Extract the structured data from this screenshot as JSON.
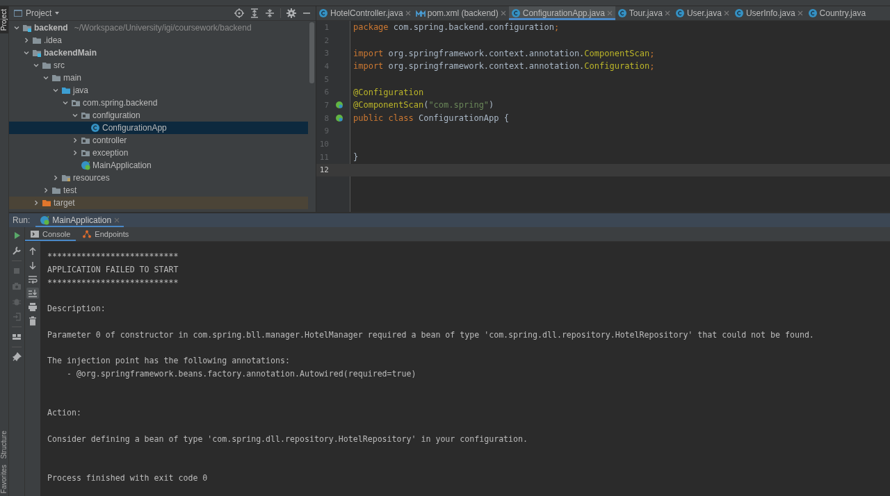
{
  "side_tools": [
    {
      "label": "Project",
      "kind": "top",
      "selected": true
    },
    {
      "label": "Structure",
      "kind": "bottom",
      "selected": false
    },
    {
      "label": "Favorites",
      "kind": "bottom",
      "selected": false
    }
  ],
  "project": {
    "title": "Project",
    "tree": [
      {
        "label": "backend",
        "kind": "module",
        "hint": "~/Workspace/University/igi/coursework/backend",
        "expanded": true,
        "selected": false,
        "children": [
          {
            "label": ".idea",
            "kind": "folder",
            "expanded": false,
            "selected": false
          },
          {
            "label": "backendMain",
            "kind": "module",
            "expanded": true,
            "selected": false,
            "children": [
              {
                "label": "src",
                "kind": "folder",
                "expanded": true,
                "selected": false,
                "children": [
                  {
                    "label": "main",
                    "kind": "folder",
                    "expanded": true,
                    "selected": false,
                    "children": [
                      {
                        "label": "java",
                        "kind": "source",
                        "expanded": true,
                        "selected": false,
                        "children": [
                          {
                            "label": "com.spring.backend",
                            "kind": "package",
                            "expanded": true,
                            "selected": false,
                            "children": [
                              {
                                "label": "configuration",
                                "kind": "package",
                                "expanded": true,
                                "selected": false,
                                "children": [
                                  {
                                    "label": "ConfigurationApp",
                                    "kind": "class",
                                    "selected": true
                                  }
                                ]
                              },
                              {
                                "label": "controller",
                                "kind": "package",
                                "expanded": false,
                                "selected": false
                              },
                              {
                                "label": "exception",
                                "kind": "package",
                                "expanded": false,
                                "selected": false
                              },
                              {
                                "label": "MainApplication",
                                "kind": "spring-class",
                                "selected": false
                              }
                            ]
                          }
                        ]
                      },
                      {
                        "label": "resources",
                        "kind": "resources",
                        "expanded": false,
                        "selected": false
                      }
                    ]
                  },
                  {
                    "label": "test",
                    "kind": "folder",
                    "expanded": false,
                    "selected": false
                  }
                ]
              },
              {
                "label": "target",
                "kind": "excluded",
                "expanded": false,
                "selected": false
              }
            ]
          }
        ]
      }
    ]
  },
  "editor": {
    "tabs": [
      {
        "label": "HotelController.java",
        "kind": "class",
        "selected": false,
        "closable": true
      },
      {
        "label": "pom.xml (backend)",
        "kind": "maven",
        "selected": false,
        "closable": true
      },
      {
        "label": "ConfigurationApp.java",
        "kind": "class",
        "selected": true,
        "closable": true
      },
      {
        "label": "Tour.java",
        "kind": "class",
        "selected": false,
        "closable": true
      },
      {
        "label": "User.java",
        "kind": "class",
        "selected": false,
        "closable": true
      },
      {
        "label": "UserInfo.java",
        "kind": "class",
        "selected": false,
        "closable": true
      },
      {
        "label": "Country.java",
        "kind": "class",
        "selected": false,
        "closable": false
      }
    ],
    "lines": [
      {
        "number": "1",
        "current": false,
        "marker": false,
        "segments": [
          {
            "text": "package",
            "kind": "keyword"
          },
          {
            "text": " com.spring.backend.configuration",
            "kind": "plain"
          },
          {
            "text": ";",
            "kind": "keyword"
          }
        ]
      },
      {
        "number": "2",
        "current": false,
        "marker": false
      },
      {
        "number": "3",
        "current": false,
        "marker": false,
        "segments": [
          {
            "text": "import",
            "kind": "keyword"
          },
          {
            "text": " org.springframework.context.annotation.",
            "kind": "plain"
          },
          {
            "text": "ComponentScan",
            "kind": "annotation"
          },
          {
            "text": ";",
            "kind": "keyword"
          }
        ]
      },
      {
        "number": "4",
        "current": false,
        "marker": false,
        "segments": [
          {
            "text": "import",
            "kind": "keyword"
          },
          {
            "text": " org.springframework.context.annotation.",
            "kind": "plain"
          },
          {
            "text": "Configuration",
            "kind": "annotation"
          },
          {
            "text": ";",
            "kind": "keyword"
          }
        ]
      },
      {
        "number": "5",
        "current": false,
        "marker": false
      },
      {
        "number": "6",
        "current": false,
        "marker": false,
        "segments": [
          {
            "text": "@Configuration",
            "kind": "annotation"
          }
        ]
      },
      {
        "number": "7",
        "current": false,
        "marker": true,
        "segments": [
          {
            "text": "@ComponentScan",
            "kind": "annotation"
          },
          {
            "text": "(",
            "kind": "plain"
          },
          {
            "text": "\"com.spring\"",
            "kind": "string"
          },
          {
            "text": ")",
            "kind": "plain"
          }
        ]
      },
      {
        "number": "8",
        "current": false,
        "marker": true,
        "segments": [
          {
            "text": "public class",
            "kind": "keyword"
          },
          {
            "text": " ConfigurationApp {",
            "kind": "plain"
          }
        ]
      },
      {
        "number": "9",
        "current": false,
        "marker": false
      },
      {
        "number": "10",
        "current": false,
        "marker": false
      },
      {
        "number": "11",
        "current": false,
        "marker": false,
        "segments": [
          {
            "text": "}",
            "kind": "plain"
          }
        ]
      },
      {
        "number": "12",
        "current": true,
        "marker": false
      }
    ]
  },
  "run": {
    "label": "Run:",
    "tabs": [
      {
        "label": "MainApplication",
        "selected": true
      }
    ],
    "subtabs": [
      {
        "label": "Console",
        "kind": "console",
        "selected": true
      },
      {
        "label": "Endpoints",
        "kind": "endpoints",
        "selected": false
      }
    ],
    "toolbar": [
      {
        "kind": "run",
        "disabled": false
      },
      {
        "kind": "wrench",
        "disabled": false
      },
      {
        "kind": "stop",
        "disabled": true
      },
      {
        "kind": "camera",
        "disabled": true
      },
      {
        "kind": "bug",
        "disabled": true
      },
      {
        "kind": "exit",
        "disabled": true
      },
      {
        "kind": "layout",
        "disabled": false
      },
      {
        "kind": "pin",
        "disabled": false
      }
    ],
    "console_toolbar": [
      {
        "kind": "up",
        "selected": false
      },
      {
        "kind": "down",
        "selected": false
      },
      {
        "kind": "wrap",
        "selected": false
      },
      {
        "kind": "scroll-end",
        "selected": true
      },
      {
        "kind": "print",
        "selected": false
      },
      {
        "kind": "trash",
        "selected": false
      }
    ],
    "console": [
      {
        "kind": "text",
        "text": "***************************"
      },
      {
        "kind": "text",
        "text": "APPLICATION FAILED TO START"
      },
      {
        "kind": "text",
        "text": "***************************"
      },
      {
        "kind": "blank"
      },
      {
        "kind": "text",
        "text": "Description:"
      },
      {
        "kind": "blank"
      },
      {
        "kind": "text",
        "text": "Parameter 0 of constructor in com.spring.bll.manager.HotelManager required a bean of type 'com.spring.dll.repository.HotelRepository' that could not be found."
      },
      {
        "kind": "blank"
      },
      {
        "kind": "text",
        "text": "The injection point has the following annotations:"
      },
      {
        "kind": "text",
        "text": "    - @org.springframework.beans.factory.annotation.Autowired(required=true)"
      },
      {
        "kind": "blank"
      },
      {
        "kind": "blank"
      },
      {
        "kind": "text",
        "text": "Action:"
      },
      {
        "kind": "blank"
      },
      {
        "kind": "text",
        "text": "Consider defining a bean of type 'com.spring.dll.repository.HotelRepository' in your configuration."
      },
      {
        "kind": "blank"
      },
      {
        "kind": "blank"
      },
      {
        "kind": "text",
        "text": "Process finished with exit code 0"
      }
    ]
  }
}
